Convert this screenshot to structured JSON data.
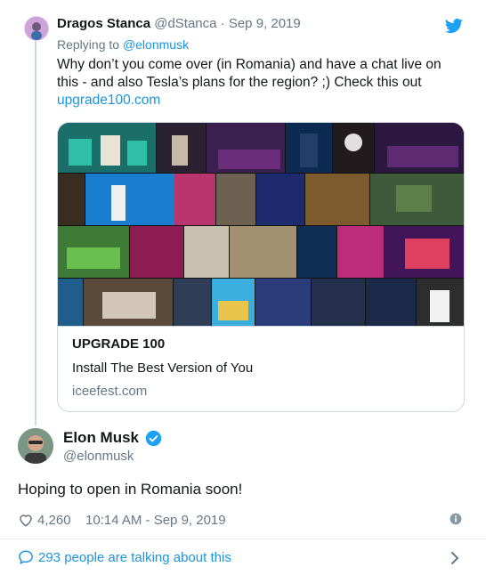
{
  "reply_tweet": {
    "author_name": "Dragos Stanca",
    "author_handle": "@dStanca",
    "date": "· Sep 9, 2019",
    "replying_to_prefix": "Replying to",
    "replying_to_handle": "@elonmusk",
    "text_line1": "Why don’t you come over (in Romania) and have a chat live on",
    "text_line2": "this - and also Tesla’s plans for the region? ;) Check this out",
    "link": "upgrade100.com",
    "card": {
      "title": "UPGRADE 100",
      "description": "Install The Best Version of You",
      "domain": "iceefest.com"
    }
  },
  "main_tweet": {
    "author_name": "Elon Musk",
    "author_handle": "@elonmusk",
    "verified": true,
    "text": "Hoping to open in Romania soon!",
    "likes": "4,260",
    "timestamp": "10:14 AM - Sep 9, 2019"
  },
  "footer": {
    "talking_text": "293 people are talking about this"
  },
  "icons": [
    "twitter-bird-icon",
    "verified-badge-icon",
    "heart-icon",
    "info-icon",
    "comment-bubble-icon",
    "chevron-right-icon"
  ],
  "colors": {
    "link": "#1b95e0",
    "muted": "#657786",
    "text": "#14171a",
    "verified": "#1da1f2"
  }
}
